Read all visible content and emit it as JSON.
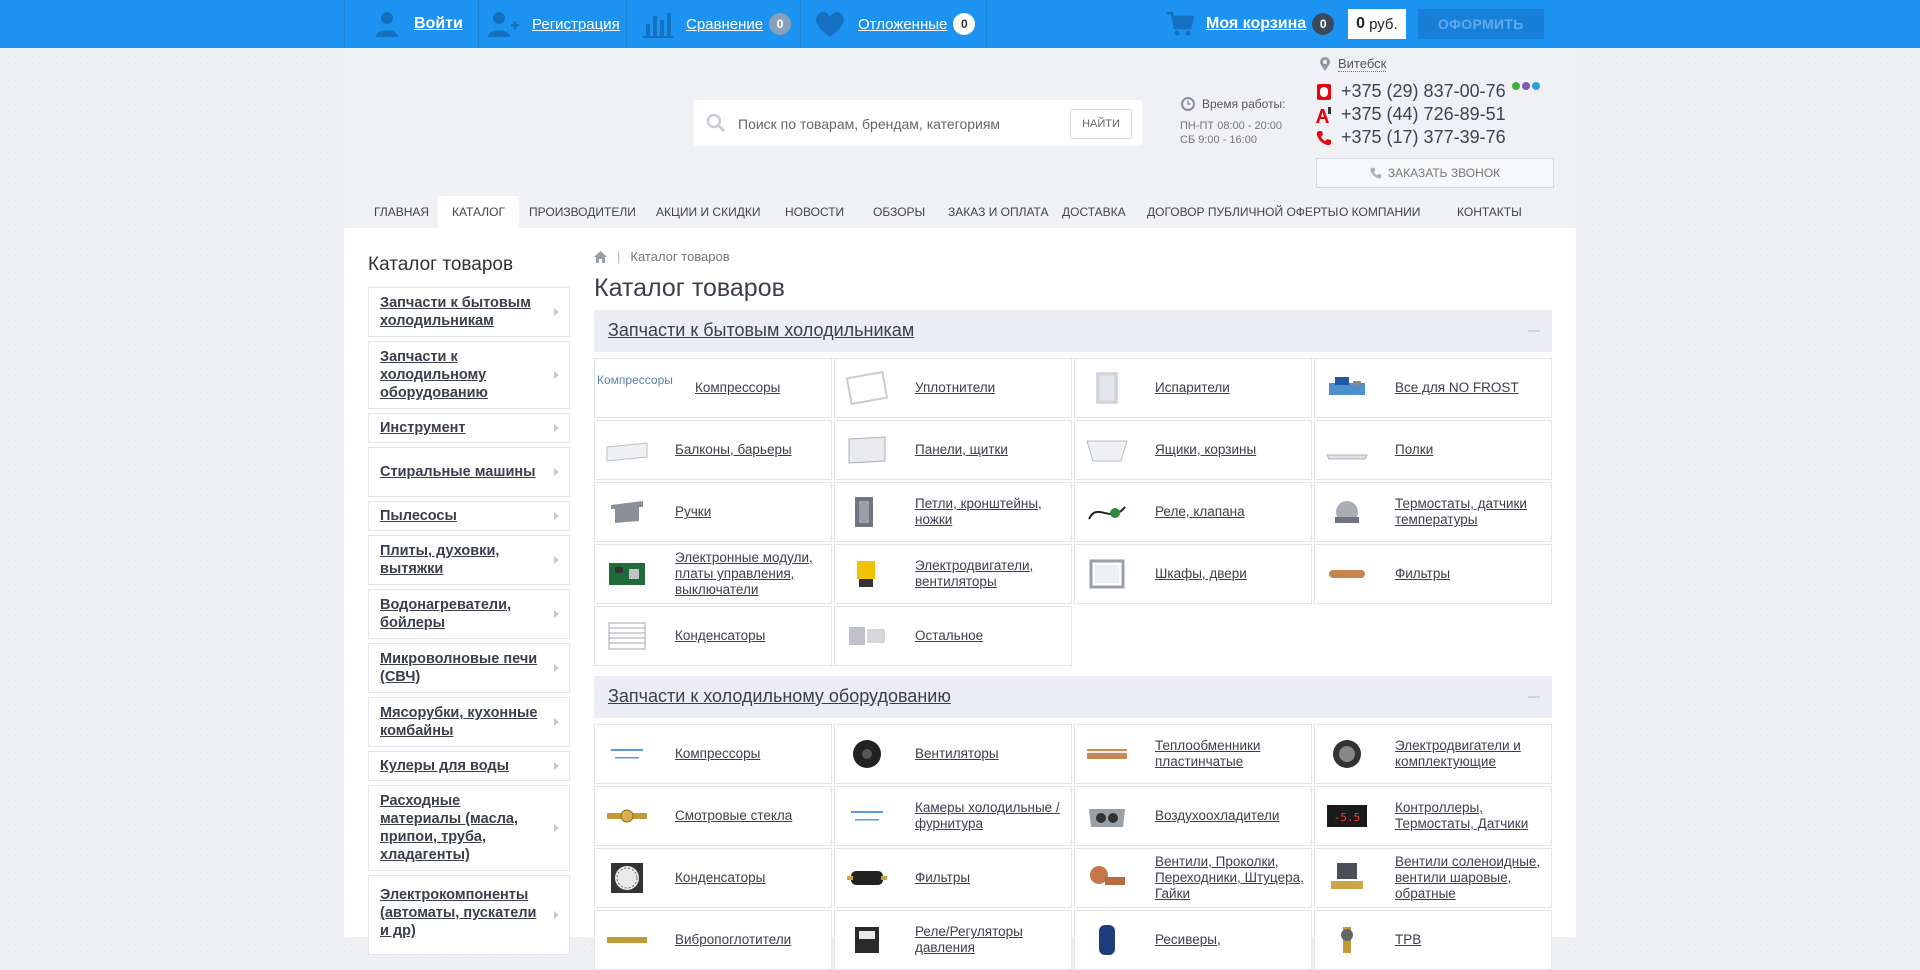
{
  "topbar": {
    "login": "Войти",
    "register": "Регистрация",
    "compare": "Сравнение",
    "compare_count": "0",
    "wishlist": "Отложенные",
    "wishlist_count": "0",
    "cart": "Моя корзина",
    "cart_count": "0",
    "price_value": "0",
    "price_currency": "руб.",
    "checkout": "ОФОРМИТЬ"
  },
  "header": {
    "search_placeholder": "Поиск по товарам, брендам, категориям",
    "search_button": "НАЙТИ",
    "worktime_title": "Время работы:",
    "worktime_weekdays": "ПН-ПТ 08:00 - 20:00",
    "worktime_saturday": "СБ 9:00 - 16:00",
    "city": "Витебск",
    "phones": [
      "+375 (29) 837-00-76",
      "+375 (44) 726-89-51",
      "+375 (17) 377-39-76"
    ],
    "callback": "ЗАКАЗАТЬ ЗВОНОК"
  },
  "nav": [
    "ГЛАВНАЯ",
    "КАТАЛОГ",
    "ПРОИЗВОДИТЕЛИ",
    "АКЦИИ И СКИДКИ",
    "НОВОСТИ",
    "ОБЗОРЫ",
    "ЗАКАЗ И ОПЛАТА",
    "ДОСТАВКА",
    "ДОГОВОР ПУБЛИЧНОЙ ОФЕРТЫ",
    "О КОМПАНИИ",
    "КОНТАКТЫ"
  ],
  "sidebar": {
    "title": "Каталог товаров",
    "items": [
      "Запчасти к бытовым холодильникам",
      "Запчасти к холодильному оборудованию",
      "Инструмент",
      "Стиральные машины",
      "Пылесосы",
      "Плиты, духовки, вытяжки",
      "Водонагреватели, бойлеры",
      "Микроволновые печи (СВЧ)",
      "Мясорубки, кухонные комбайны",
      "Кулеры для воды",
      "Расходные материалы (масла, припои, труба, хладагенты)",
      "Электрокомпоненты (автоматы, пускатели и др)"
    ]
  },
  "breadcrumbs": {
    "current": "Каталог товаров"
  },
  "main": {
    "title": "Каталог товаров",
    "sections": [
      {
        "title": "Запчасти к бытовым холодильникам",
        "broken_image_alt": "Компрессоры",
        "tiles": [
          "Компрессоры",
          "Уплотнители",
          "Испарители",
          "Все для NO FROST",
          "Балконы, барьеры",
          "Панели, щитки",
          "Ящики, корзины",
          "Полки",
          "Ручки",
          "Петли, кронштейны, ножки",
          "Реле, клапана",
          "Термостаты, датчики температуры",
          "Электронные модули, платы управления, выключатели",
          "Электродвигатели, вентиляторы",
          "Шкафы, двери",
          "Фильтры",
          "Конденсаторы",
          "Остальное"
        ]
      },
      {
        "title": "Запчасти к холодильному оборудованию",
        "tiles": [
          "Компрессоры",
          "Вентиляторы",
          "Теплообменники пластинчатые",
          "Электродвигатели и комплектующие",
          "Смотровые стекла",
          "Камеры холодильные / фурнитура",
          "Воздухоохладители",
          "Контроллеры, Термостаты, Датчики",
          "Конденсаторы",
          "Фильтры",
          "Вентили, Проколки, Переходники, Штуцера, Гайки",
          "Вентили соленоидные, вентили шаровые, обратные",
          "Вибропоглотители",
          "Реле/Регуляторы давления",
          "Ресиверы,",
          "ТРВ"
        ]
      }
    ]
  },
  "colors": {
    "topbar": "#1c93f0",
    "checkout_button": "#1680d8",
    "section_header": "#ebecf4"
  },
  "icons": [
    "user-icon",
    "user-plus-icon",
    "bar-chart-icon",
    "heart-icon",
    "cart-icon",
    "search-icon",
    "clock-icon",
    "map-pin-icon",
    "mts-icon",
    "a1-icon",
    "phone-icon",
    "home-icon"
  ]
}
